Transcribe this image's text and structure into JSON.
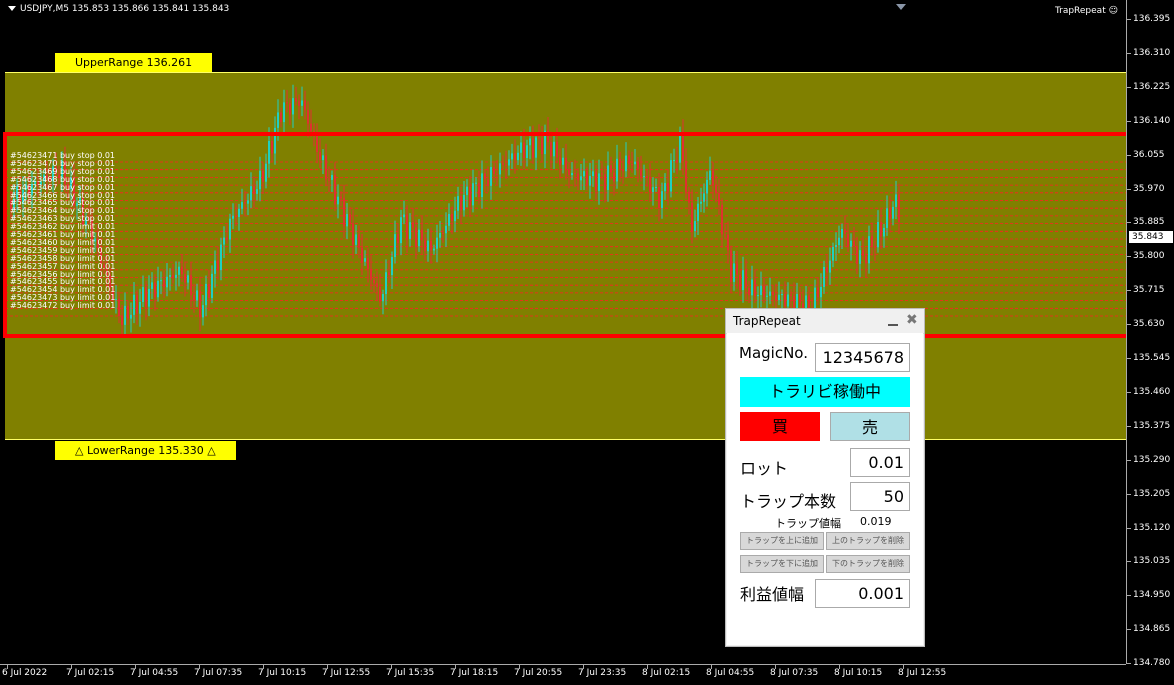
{
  "chart": {
    "symbol_info": "USDJPY,M5  135.853 135.866 135.841 135.843",
    "ea_name": "TrapRepeat",
    "ea_icon": "smiley-icon",
    "upper_range_label": "UpperRange 136.261",
    "lower_range_label": "△ LowerRange 135.330 △",
    "bid_price": "35.843",
    "colors": {
      "background": "#000000",
      "range_fill": "#808000",
      "range_label": "#ffff00",
      "bull_candle": "#20d0c0",
      "bear_candle": "#e03030",
      "order_line": "#ff2020",
      "highlight_box": "#ff0000"
    },
    "price_axis": [
      "136.395",
      "136.310",
      "136.225",
      "136.140",
      "36.055",
      "35.970",
      "35.885",
      "35.800",
      "35.715",
      "35.630",
      "135.545",
      "135.460",
      "135.375",
      "135.290",
      "135.205",
      "135.120",
      "135.035",
      "134.950",
      "134.865",
      "134.780"
    ],
    "time_axis": [
      "6 Jul 2022",
      "7 Jul 02:15",
      "7 Jul 04:55",
      "7 Jul 07:35",
      "7 Jul 10:15",
      "7 Jul 12:55",
      "7 Jul 15:35",
      "7 Jul 18:15",
      "7 Jul 20:55",
      "7 Jul 23:35",
      "8 Jul 02:15",
      "8 Jul 04:55",
      "8 Jul 07:35",
      "8 Jul 10:15",
      "8 Jul 12:55"
    ],
    "order_labels": [
      "#54623471 buy stop 0.01",
      "#54623470 buy stop 0.01",
      "#54623469 buy stop 0.01",
      "#54623468 buy stop 0.01",
      "#54623467 buy stop 0.01",
      "#54623466 buy stop 0.01",
      "#54623465 buy stop 0.01",
      "#54623464 buy stop 0.01",
      "#54623463 buy stop 0.01",
      "#54623462 buy limit 0.01",
      "#54623461 buy limit 0.01",
      "#54623460 buy limit 0.01",
      "#54623459 buy limit 0.01",
      "#54623458 buy limit 0.01",
      "#54623457 buy limit 0.01",
      "#54623456 buy limit 0.01",
      "#54623455 buy limit 0.01",
      "#54623454 buy limit 0.01",
      "#54623473 buy limit 0.01",
      "#54623472 buy limit 0.01"
    ]
  },
  "panel": {
    "title": "TrapRepeat",
    "magic_label": "MagicNo.",
    "magic_value": "12345678",
    "status_button": "トラリビ稼働中",
    "buy_button": "買",
    "sell_button": "売",
    "lot_label": "ロット",
    "lot_value": "0.01",
    "trap_count_label": "トラップ本数",
    "trap_count_value": "50",
    "trap_width_label": "トラップ値幅",
    "trap_width_value": "0.019",
    "add_above_button": "トラップを上に追加",
    "delete_above_button": "上のトラップを削除",
    "add_below_button": "トラップを下に追加",
    "delete_below_button": "下のトラップを削除",
    "profit_label": "利益値幅",
    "profit_value": "0.001",
    "colors": {
      "status_bg": "#00ffff",
      "buy_bg": "#ff0000",
      "sell_bg": "#b0e0e6"
    }
  }
}
